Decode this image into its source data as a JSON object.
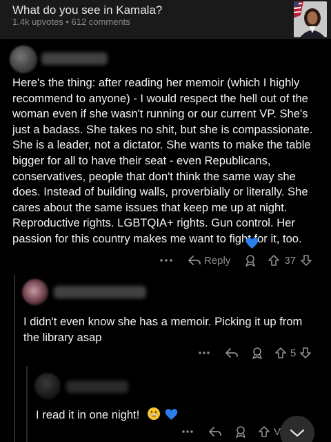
{
  "post": {
    "title": "What do you see in Kamala?",
    "meta": "1.4k upvotes • 612 comments"
  },
  "comments": [
    {
      "text": "Here's the thing: after reading her memoir (which I highly recommend to anyone) - I would respect the hell out of the woman even if she wasn't running or our current VP. She's just a badass. She takes no shit, but she is compassionate. She is a leader, not a dictator. She wants to make the table bigger for all to have their seat - even Republicans, conservatives, people that don't think the same way she does. Instead of building walls, proverbially or literally. She cares about the same issues that keep me up at night. Reproductive rights. LGBTQIA+ rights. Gun control. Her passion for this country makes me want to fight for it, too.",
      "reply_label": "Reply",
      "votes": "37"
    },
    {
      "text": "I didn't even know she has a memoir. Picking it up from the library asap",
      "votes": "5"
    },
    {
      "text": "I read it in one night!",
      "votes": "Vo"
    }
  ],
  "colors": {
    "background": "#000000",
    "muted": "#8f8f8f",
    "heart": "#2b7de9"
  }
}
